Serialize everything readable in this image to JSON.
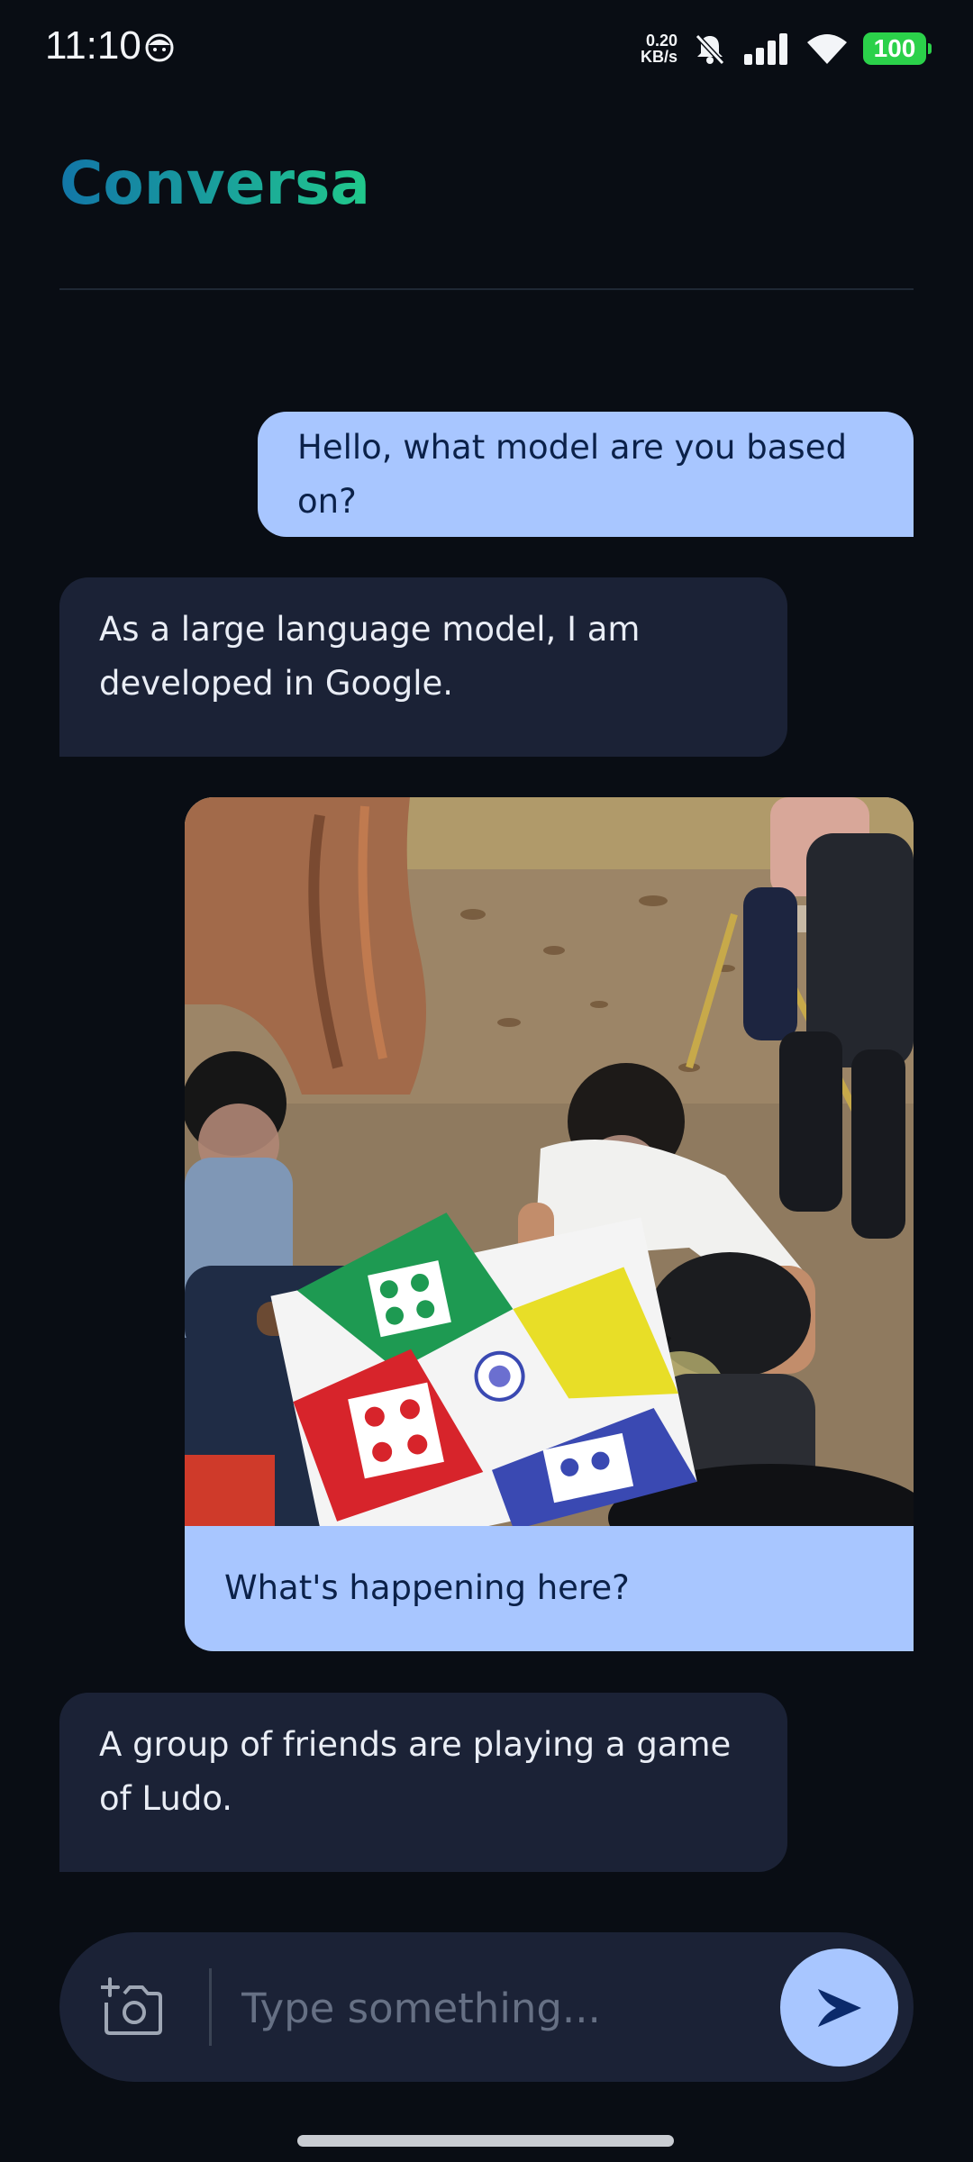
{
  "status_bar": {
    "time": "11:10",
    "net_speed_value": "0.20",
    "net_speed_unit": "KB/s",
    "battery": "100",
    "icons": [
      "face-notification-icon",
      "mute-icon",
      "signal-icon",
      "wifi-icon",
      "battery-icon"
    ]
  },
  "header": {
    "title": "Conversa"
  },
  "messages": [
    {
      "role": "user",
      "text": "Hello, what model are you based on?"
    },
    {
      "role": "assistant",
      "text": "As a large language model, I am developed in Google."
    },
    {
      "role": "user",
      "image": "ludo-board-game-photo",
      "text": "What's happening here?"
    },
    {
      "role": "assistant",
      "text": "A group of friends are playing a game of Ludo."
    }
  ],
  "input": {
    "placeholder": "Type something...",
    "value": ""
  },
  "colors": {
    "background": "#090d14",
    "user_bubble": "#a8c6ff",
    "assistant_bubble": "#1b2236",
    "title_gradient_start": "#1276a8",
    "title_gradient_end": "#21c98b",
    "battery": "#2bd14a"
  }
}
